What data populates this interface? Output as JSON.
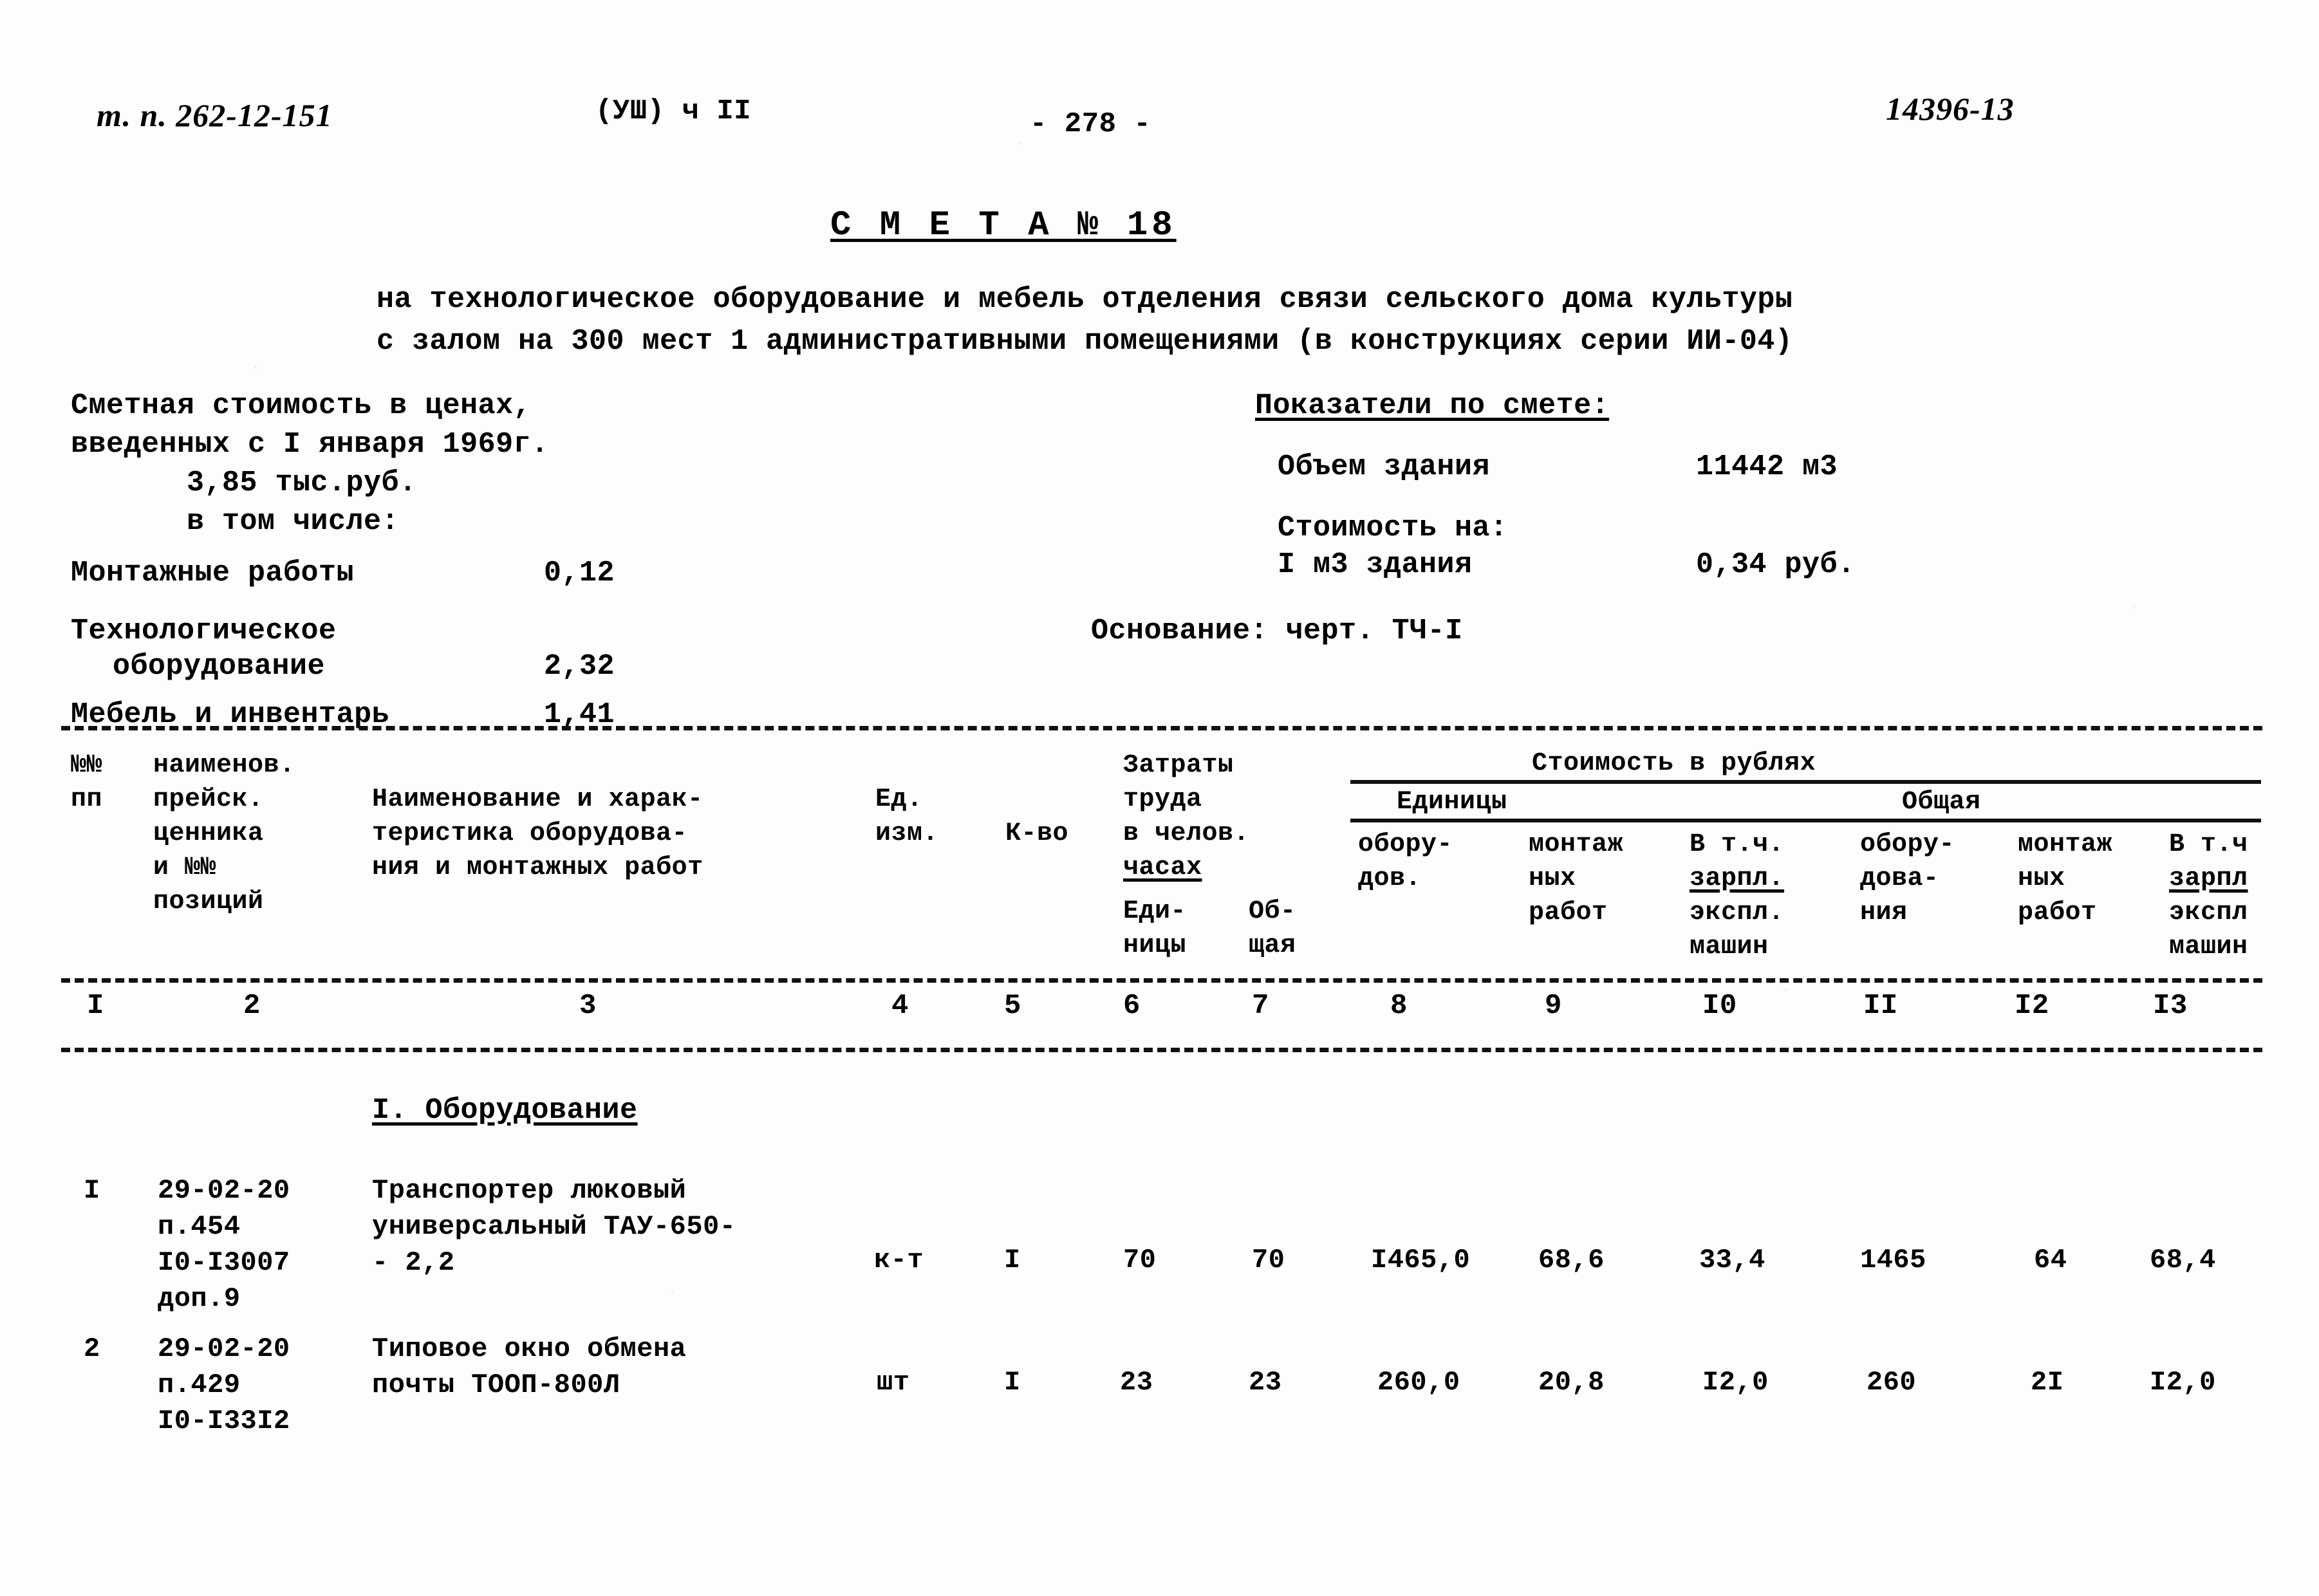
{
  "page": {
    "doc_code": "т. п. 262-12-151",
    "volume_mark": "(УШ) ч II",
    "page_number": "- 278 -",
    "handwritten_number": "14396-13"
  },
  "title": {
    "heading": "С М Е Т А № 18",
    "subtitle_line1": "на технологическое оборудование и мебель отделения связи сельского дома культуры",
    "subtitle_line2": "с залом на 300 мест 1 административными помещениями (в конструкциях серии ИИ-04)"
  },
  "cost_summary": {
    "heading_line1": "Сметная стоимость в ценах,",
    "heading_line2": "введенных с I января 1969г.",
    "total": "3,85 тыс.руб.",
    "breakdown_label": "в том числе:",
    "items": [
      {
        "label": "Монтажные работы",
        "value": "0,12"
      },
      {
        "label": "Технологическое",
        "label2": "оборудование",
        "value": "2,32"
      },
      {
        "label": "Мебель и инвентарь",
        "value": "1,41"
      }
    ]
  },
  "indicators": {
    "heading": "Показатели по смете:",
    "rows": [
      {
        "label": "Объем здания",
        "value": "11442 м3"
      },
      {
        "label": "Стоимость на:",
        "label2": "I м3 здания",
        "value": "0,34 руб."
      }
    ],
    "basis": "Основание: черт. ТЧ-I"
  },
  "table": {
    "headers": {
      "col1": [
        "№№",
        "пп"
      ],
      "col2": [
        "наименов.",
        "прейск.",
        "ценника",
        "и №№",
        "позиций"
      ],
      "col3": [
        "Наименование и харак-",
        "теристика оборудова-",
        "ния и монтажных работ"
      ],
      "col4": [
        "Ед.",
        "изм."
      ],
      "col5": [
        "К-во"
      ],
      "labor_group": [
        "Затраты",
        "труда",
        "в челов.",
        "часах"
      ],
      "col6": [
        "Еди-",
        "ницы"
      ],
      "col7": [
        "Об-",
        "щая"
      ],
      "cost_group": "Стоимость в рублях",
      "unit_group": "Единицы",
      "total_group": "Общая",
      "col8": [
        "обору-",
        "дов."
      ],
      "col9": [
        "монтаж",
        "ных",
        "работ"
      ],
      "col10": [
        "В т.ч.",
        "зарпл.",
        "экспл.",
        "машин"
      ],
      "col11": [
        "обору-",
        "дова-",
        "ния"
      ],
      "col12": [
        "монтаж",
        "ных",
        "работ"
      ],
      "col13": [
        "В т.ч",
        "зарпл",
        "экспл",
        "машин"
      ]
    },
    "column_numbers": [
      "I",
      "2",
      "3",
      "4",
      "5",
      "6",
      "7",
      "8",
      "9",
      "I0",
      "II",
      "I2",
      "I3"
    ],
    "section_heading": "I. Оборудование",
    "rows": [
      {
        "no": "I",
        "price_ref": [
          "29-02-20",
          "п.454",
          "I0-I3007",
          "доп.9"
        ],
        "description": [
          "Транспортер люковый",
          "универсальный ТАУ-650-",
          "- 2,2"
        ],
        "unit": "к-т",
        "qty": "I",
        "labor_unit": "70",
        "labor_total": "70",
        "cost_unit_equip": "I465,0",
        "cost_unit_install": "68,6",
        "cost_unit_wages": "33,4",
        "cost_total_equip": "1465",
        "cost_total_install": "64",
        "cost_total_wages": "68,4"
      },
      {
        "no": "2",
        "price_ref": [
          "29-02-20",
          "п.429",
          "I0-I33I2"
        ],
        "description": [
          "Типовое окно обмена",
          "почты ТООП-800Л"
        ],
        "unit": "шт",
        "qty": "I",
        "labor_unit": "23",
        "labor_total": "23",
        "cost_unit_equip": "260,0",
        "cost_unit_install": "20,8",
        "cost_unit_wages": "I2,0",
        "cost_total_equip": "260",
        "cost_total_install": "2I",
        "cost_total_wages": "I2,0"
      }
    ]
  }
}
